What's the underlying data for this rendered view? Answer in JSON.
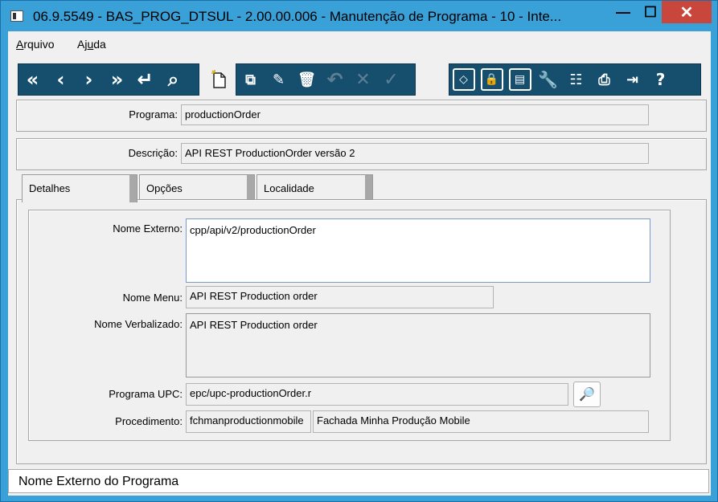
{
  "window": {
    "title": "06.9.5549 - BAS_PROG_DTSUL - 2.00.00.006 - Manutenção de Programa - 10 - Inte...",
    "minimize_label": "—",
    "maximize_label": "☐",
    "close_label": "✕"
  },
  "menu": {
    "arquivo": {
      "first": "A",
      "rest": "rquivo"
    },
    "ajuda": {
      "first": "Aj",
      "u": "u",
      "rest": "da"
    }
  },
  "toolbar": {
    "icons": [
      "first-record-icon",
      "previous-record-icon",
      "next-record-icon",
      "last-record-icon",
      "goto-icon",
      "search-icon",
      "new-icon",
      "copy-icon",
      "edit-icon",
      "delete-icon",
      "undo-icon",
      "cancel-icon",
      "confirm-icon",
      "code-icon",
      "lock-icon",
      "record-icon",
      "tools-icon",
      "tree-icon",
      "print-icon",
      "exit-icon",
      "help-icon"
    ]
  },
  "header": {
    "programa_label": "Programa:",
    "programa_value": "productionOrder",
    "descricao_label": "Descrição:",
    "descricao_value": "API REST ProductionOrder versão 2"
  },
  "tabs": [
    {
      "label": "Detalhes",
      "active": true
    },
    {
      "label": "Opções",
      "active": false
    },
    {
      "label": "Localidade",
      "active": false
    }
  ],
  "details": {
    "nome_externo_label": "Nome Externo:",
    "nome_externo_value": "cpp/api/v2/productionOrder",
    "nome_menu_label": "Nome Menu:",
    "nome_menu_value": "API REST Production order",
    "nome_verbalizado_label": "Nome Verbalizado:",
    "nome_verbalizado_value": "API REST Production order",
    "programa_upc_label": "Programa UPC:",
    "programa_upc_value": "epc/upc-productionOrder.r",
    "procedimento_label": "Procedimento:",
    "procedimento_code": "fchmanproductionmobile",
    "procedimento_desc": "Fachada Minha Produção Mobile"
  },
  "status": {
    "text": "Nome Externo do Programa"
  },
  "colors": {
    "titlebar": "#3aa0d8",
    "toolbar": "#164e6e",
    "close": "#c9463d"
  }
}
